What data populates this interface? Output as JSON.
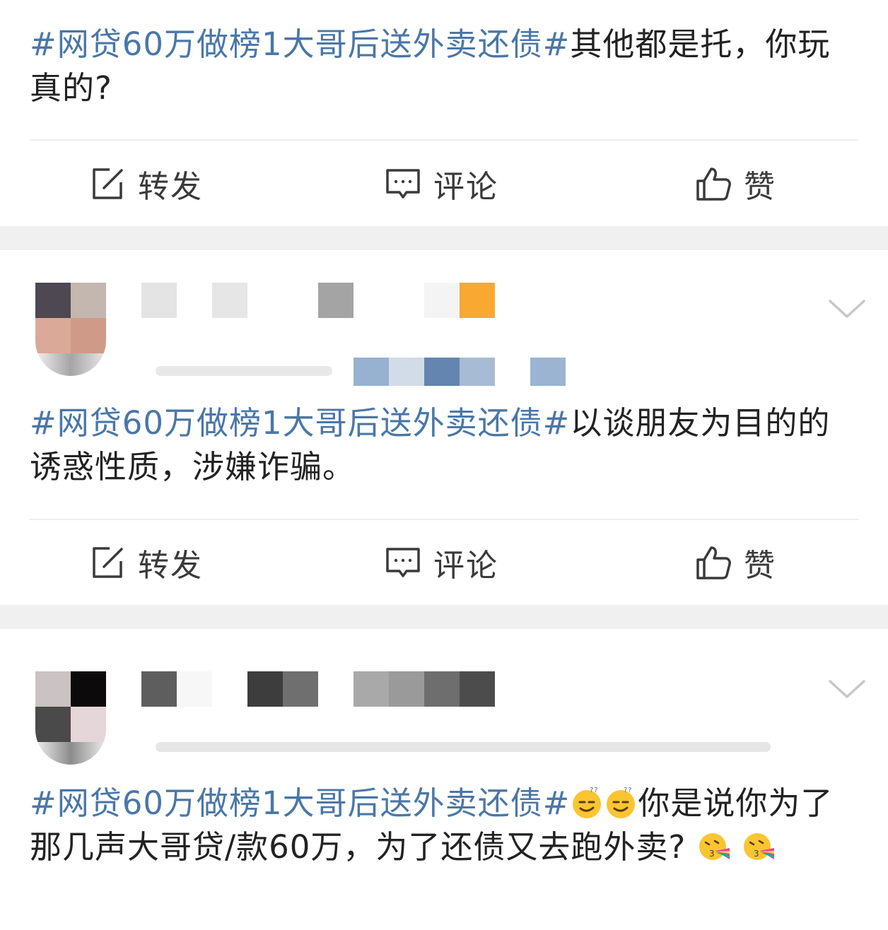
{
  "posts": [
    {
      "hashtag": "#网贷60万做榜1大哥后送外卖还债#",
      "text": "其他都是托，你玩真的?",
      "actions": {
        "repost": "转发",
        "comment": "评论",
        "like": "赞"
      }
    },
    {
      "hashtag": "#网贷60万做榜1大哥后送外卖还债#",
      "text": "以谈朋友为目的的诱惑性质，涉嫌诈骗。",
      "actions": {
        "repost": "转发",
        "comment": "评论",
        "like": "赞"
      }
    },
    {
      "hashtag": "#网贷60万做榜1大哥后送外卖还债#",
      "text_part1": "你是说你为了那几声大哥贷/款60万，为了还债又去跑外卖?",
      "emojis": [
        "smirk-emoji",
        "smirk-emoji",
        "rainbow-puke-emoji",
        "rainbow-puke-emoji"
      ]
    }
  ],
  "colors": {
    "hashtag": "#4a77a8",
    "text": "#222222",
    "separator_band": "#f0f0f0",
    "divider": "#eeeeee",
    "icon": "#3a3a3a"
  }
}
